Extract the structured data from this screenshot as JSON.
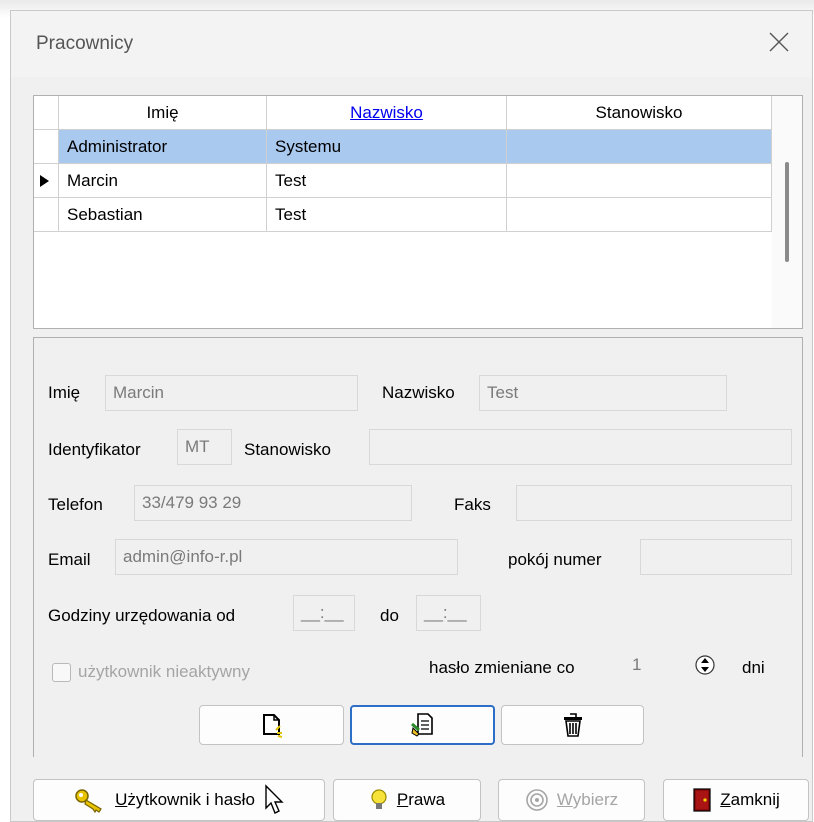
{
  "window": {
    "title": "Pracownicy"
  },
  "grid": {
    "columns": [
      "Imię",
      "Nazwisko",
      "Stanowisko"
    ],
    "rows": [
      {
        "imie": "Administrator",
        "nazwisko": "Systemu",
        "stanowisko": "",
        "selected": true,
        "current": false
      },
      {
        "imie": "Marcin",
        "nazwisko": "Test",
        "stanowisko": "",
        "selected": false,
        "current": true
      },
      {
        "imie": "Sebastian",
        "nazwisko": "Test",
        "stanowisko": "",
        "selected": false,
        "current": false
      }
    ]
  },
  "form": {
    "imie_label": "Imię",
    "imie_value": "Marcin",
    "nazwisko_label": "Nazwisko",
    "nazwisko_value": "Test",
    "identyfikator_label": "Identyfikator",
    "identyfikator_value": "MT",
    "stanowisko_label": "Stanowisko",
    "stanowisko_value": "",
    "telefon_label": "Telefon",
    "telefon_value": "33/479 93 29",
    "faks_label": "Faks",
    "faks_value": "",
    "email_label": "Email",
    "email_value": "admin@info-r.pl",
    "pokoj_label": "pokój numer",
    "pokoj_value": "",
    "godziny_label": "Godziny urzędowania od",
    "godziny_od_value": "__:__",
    "do_label": "do",
    "godziny_do_value": "__:__",
    "nieaktywny_label": "użytkownik nieaktywny",
    "haslo_label": "hasło zmieniane co",
    "haslo_value": "1",
    "dni_label": "dni"
  },
  "toolbar": {
    "new_icon": "new-document-icon",
    "edit_icon": "edit-document-icon",
    "delete_icon": "trash-icon"
  },
  "buttons": {
    "user_prefix": "U",
    "user_rest": "żytkownik i hasło",
    "prawa_prefix": "P",
    "prawa_rest": "rawa",
    "wybierz_prefix": "W",
    "wybierz_rest": "ybierz",
    "zamknij_prefix": "Z",
    "zamknij_rest": "amknij"
  },
  "colors": {
    "selection": "#aac9ee",
    "focus": "#2d6ec6",
    "link": "#0000ee"
  }
}
